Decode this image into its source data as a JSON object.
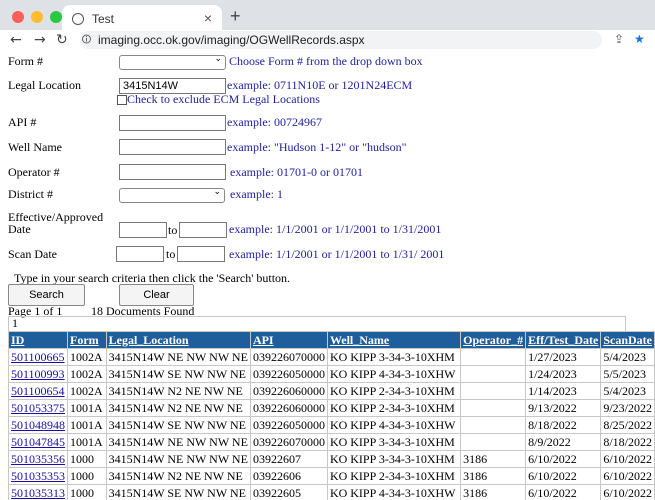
{
  "browser": {
    "tab_title": "Test",
    "tab_close": "×",
    "new_tab": "+",
    "url": "imaging.occ.ok.gov/imaging/OGWellRecords.aspx",
    "back": "←",
    "forward": "→",
    "reload": "↻",
    "share": "⇪",
    "star": "★"
  },
  "form": {
    "form_label": "Form #",
    "form_hint": "Choose Form # from the drop down box",
    "legal_label": "Legal Location",
    "legal_value": "3415N14W",
    "legal_example": "example: 0711N10E or 1201N24ECM",
    "exclude_ecm": "Check to exclude ECM Legal Locations",
    "api_label": "API #",
    "api_example": "example: 00724967",
    "well_label": "Well Name",
    "well_example": "example: \"Hudson 1-12\" or \"hudson\"",
    "operator_label": "Operator #",
    "operator_example": "example: 01701-0 or 01701",
    "district_label": "District #",
    "district_example": "example: 1",
    "eff_label_1": "Effective/Approved",
    "eff_label_2": "Date",
    "to1": "to",
    "eff_example": "example: 1/1/2001 or 1/1/2001 to 1/31/2001",
    "scan_label": "Scan Date",
    "to2": "to",
    "scan_example": "example: 1/1/2001 or 1/1/2001 to 1/31/ 2001",
    "instructions": "Type in your search criteria then click the 'Search' button.",
    "search_button": "Search",
    "clear_button": "Clear"
  },
  "results": {
    "page_info": "Page 1 of 1",
    "count": "18 Documents Found",
    "pager": "1",
    "headers": [
      "ID",
      "Form",
      "Legal_Location",
      "API",
      "Well_Name",
      "Operator_#",
      "Eff/Test_Date",
      "ScanDate"
    ],
    "rows": [
      [
        "501100665",
        "1002A",
        "3415N14W NE NW NW NE",
        "039226070000",
        "KO KIPP 3-34-3-10XHM",
        "",
        "1/27/2023",
        "5/4/2023"
      ],
      [
        "501100993",
        "1002A",
        "3415N14W SE NW NW NE",
        "039226050000",
        "KO KIPP 4-34-3-10XHW",
        "",
        "1/24/2023",
        "5/5/2023"
      ],
      [
        "501100654",
        "1002A",
        "3415N14W N2 NE NW NE",
        "039226060000",
        "KO KIPP 2-34-3-10XHM",
        "",
        "1/14/2023",
        "5/4/2023"
      ],
      [
        "501053375",
        "1001A",
        "3415N14W N2 NE NW NE",
        "039226060000",
        "KO KIPP 2-34-3-10XHM",
        "",
        "9/13/2022",
        "9/23/2022"
      ],
      [
        "501048948",
        "1001A",
        "3415N14W SE NW NW NE",
        "039226050000",
        "KO KIPP 4-34-3-10XHW",
        "",
        "8/18/2022",
        "8/25/2022"
      ],
      [
        "501047845",
        "1001A",
        "3415N14W NE NW NW NE",
        "039226070000",
        "KO KIPP 3-34-3-10XHM",
        "",
        "8/9/2022",
        "8/18/2022"
      ],
      [
        "501035356",
        "1000",
        "3415N14W NE NW NW NE",
        "03922607",
        "KO KIPP 3-34-3-10XHM",
        "3186",
        "6/10/2022",
        "6/10/2022"
      ],
      [
        "501035353",
        "1000",
        "3415N14W N2 NE NW NE",
        "03922606",
        "KO KIPP 2-34-3-10XHM",
        "3186",
        "6/10/2022",
        "6/10/2022"
      ],
      [
        "501035313",
        "1000",
        "3415N14W SE NW NW NE",
        "03922605",
        "KO KIPP 4-34-3-10XHW",
        "3186",
        "6/10/2022",
        "6/10/2022"
      ]
    ]
  },
  "colors": {
    "header_bg": "#1f5e9c",
    "example_text": "#1e1ea0",
    "link": "#1a0dab"
  }
}
